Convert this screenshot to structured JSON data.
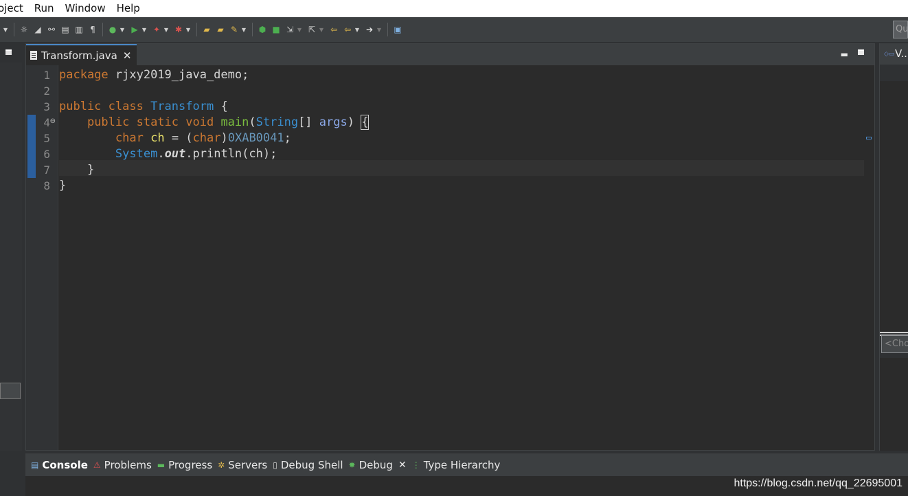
{
  "menu": {
    "items": [
      "oject",
      "Run",
      "Window",
      "Help"
    ]
  },
  "toolbar": {
    "icons": [
      "dropdown-icon",
      "debug-icon",
      "pencil-icon",
      "link-icon",
      "save-all-icon",
      "print-icon",
      "pilcrow-icon",
      "run-icon",
      "run-green-icon",
      "run-debug-icon",
      "coverage-icon",
      "open-type-icon",
      "open-folder-icon",
      "build-icon",
      "bug-icon",
      "stop-icon",
      "step-into-icon",
      "step-over-icon",
      "back-icon",
      "forward-icon",
      "next-icon",
      "perspective-icon"
    ],
    "quick_access": "Qu"
  },
  "editor": {
    "tab_label": "Transform.java",
    "lines": [
      {
        "num": "1"
      },
      {
        "num": "2"
      },
      {
        "num": "3"
      },
      {
        "num": "4"
      },
      {
        "num": "5"
      },
      {
        "num": "6"
      },
      {
        "num": "7"
      },
      {
        "num": "8"
      }
    ],
    "code": {
      "l1_kw": "package",
      "l1_rest": " rjxy2019_java_demo;",
      "l3_kw": "public class",
      "l3_type": "Transform",
      "l3_rest": " {",
      "l4_indent": "    ",
      "l4_kw": "public static void",
      "l4_method": "main",
      "l4_paren": "(",
      "l4_type": "String",
      "l4_arr": "[] ",
      "l4_param": "args",
      "l4_close": ") ",
      "l4_brace": "{",
      "l5_indent": "        ",
      "l5_kw": "char",
      "l5_sp": " ",
      "l5_local": "ch",
      "l5_eq": " = (",
      "l5_kw2": "char",
      "l5_cp": ")",
      "l5_num": "0XAB0041",
      "l5_semi": ";",
      "l6_indent": "        ",
      "l6_type": "System",
      "l6_dot": ".",
      "l6_field": "out",
      "l6_rest": ".println(ch);",
      "l7": "    }",
      "l8": "}"
    }
  },
  "right_panel": {
    "title": "V..",
    "filter_placeholder": "<Cho"
  },
  "bottom_tabs": [
    {
      "label": "Console",
      "icon": "console-icon"
    },
    {
      "label": "Problems",
      "icon": "problems-icon"
    },
    {
      "label": "Progress",
      "icon": "progress-icon"
    },
    {
      "label": "Servers",
      "icon": "servers-icon"
    },
    {
      "label": "Debug Shell",
      "icon": "debug-shell-icon"
    },
    {
      "label": "Debug",
      "icon": "debug-icon"
    },
    {
      "label": "Type Hierarchy",
      "icon": "type-hierarchy-icon"
    }
  ],
  "watermark": "https://blog.csdn.net/qq_22695001"
}
